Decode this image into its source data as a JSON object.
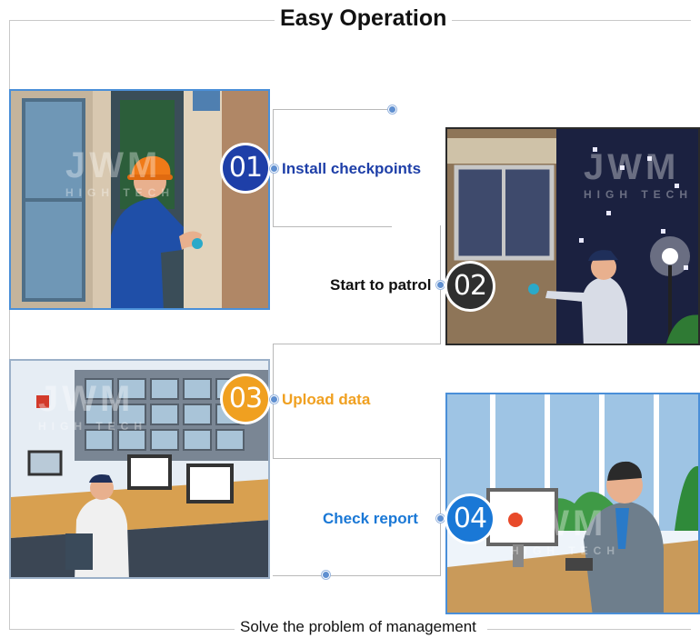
{
  "header": {
    "title": "Easy Operation"
  },
  "footer": {
    "caption": "Solve the problem of management"
  },
  "steps": [
    {
      "number": "01",
      "label": "Install checkpoints",
      "badge_color": "#1e3fa8",
      "label_color": "#1e3fa8"
    },
    {
      "number": "02",
      "label": "Start to patrol",
      "badge_color": "#2f2f2f",
      "label_color": "#111111"
    },
    {
      "number": "03",
      "label": "Upload data",
      "badge_color": "#f0a020",
      "label_color": "#f0a020"
    },
    {
      "number": "04",
      "label": "Check report",
      "badge_color": "#1a78d6",
      "label_color": "#1a78d6"
    }
  ],
  "watermark": {
    "brand": "JWM",
    "sub": "HIGH TECH"
  }
}
